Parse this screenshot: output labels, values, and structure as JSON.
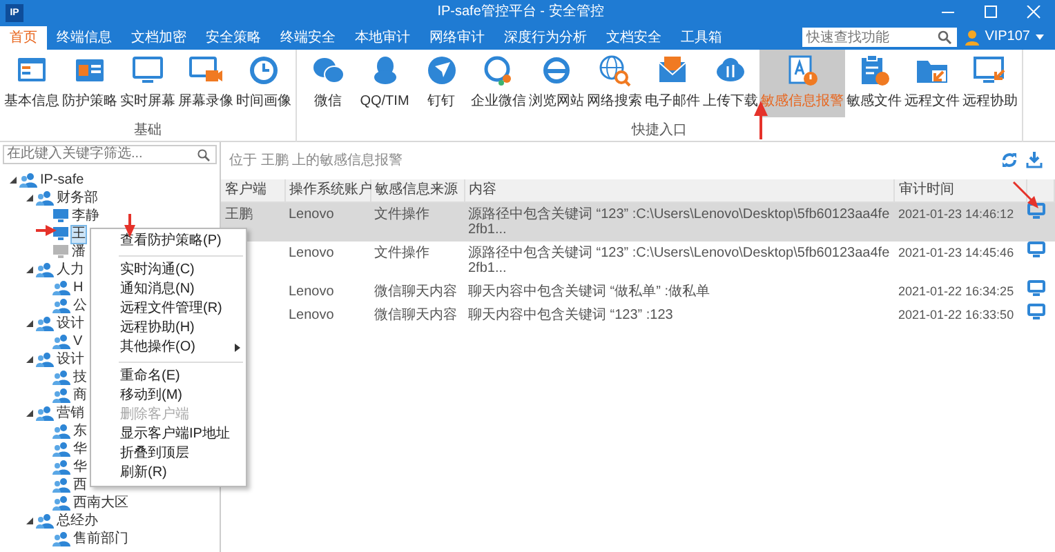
{
  "window": {
    "logo": "IP",
    "title": "IP-safe管控平台 - 安全管控"
  },
  "tabs": [
    {
      "label": "首页",
      "selected": true
    },
    {
      "label": "终端信息",
      "selected": false
    },
    {
      "label": "文档加密",
      "selected": false
    },
    {
      "label": "安全策略",
      "selected": false
    },
    {
      "label": "终端安全",
      "selected": false
    },
    {
      "label": "本地审计",
      "selected": false
    },
    {
      "label": "网络审计",
      "selected": false
    },
    {
      "label": "深度行为分析",
      "selected": false
    },
    {
      "label": "文档安全",
      "selected": false
    },
    {
      "label": "工具箱",
      "selected": false
    }
  ],
  "quick_search": {
    "placeholder": "快速查找功能"
  },
  "user": {
    "name": "VIP107"
  },
  "ribbon": {
    "groups": [
      {
        "title": "基础",
        "buttons": [
          {
            "label": "基本信息",
            "selected": false
          },
          {
            "label": "防护策略",
            "selected": false
          },
          {
            "label": "实时屏幕",
            "selected": false
          },
          {
            "label": "屏幕录像",
            "selected": false
          },
          {
            "label": "时间画像",
            "selected": false
          }
        ]
      },
      {
        "title": "快捷入口",
        "buttons": [
          {
            "label": "微信",
            "selected": false
          },
          {
            "label": "QQ/TIM",
            "selected": false
          },
          {
            "label": "钉钉",
            "selected": false
          },
          {
            "label": "企业微信",
            "selected": false
          },
          {
            "label": "浏览网站",
            "selected": false
          },
          {
            "label": "网络搜索",
            "selected": false
          },
          {
            "label": "电子邮件",
            "selected": false
          },
          {
            "label": "上传下载",
            "selected": false
          },
          {
            "label": "敏感信息报警",
            "selected": true
          },
          {
            "label": "敏感文件",
            "selected": false
          },
          {
            "label": "远程文件",
            "selected": false
          },
          {
            "label": "远程协助",
            "selected": false
          }
        ]
      }
    ]
  },
  "sidebar": {
    "filter": {
      "placeholder": "在此键入关键字筛选..."
    },
    "tree": [
      {
        "kind": "group",
        "label": "IP-safe",
        "selected": false,
        "expanded": true,
        "children": [
          {
            "kind": "group",
            "label": "财务部",
            "selected": false,
            "expanded": true,
            "children": [
              {
                "kind": "client",
                "label": "李静",
                "selected": false,
                "online": true
              },
              {
                "kind": "client",
                "label": "王",
                "selected": true,
                "online": true
              },
              {
                "kind": "client",
                "label": "潘",
                "selected": false,
                "online": false
              }
            ]
          },
          {
            "kind": "group",
            "label": "人力",
            "selected": false,
            "expanded": true,
            "children": [
              {
                "kind": "group",
                "label": "H",
                "selected": false
              },
              {
                "kind": "group",
                "label": "公",
                "selected": false
              }
            ]
          },
          {
            "kind": "group",
            "label": "设计",
            "selected": false,
            "expanded": true,
            "children": [
              {
                "kind": "group",
                "label": "V",
                "selected": false
              }
            ]
          },
          {
            "kind": "group",
            "label": "设计",
            "selected": false,
            "expanded": true,
            "children": [
              {
                "kind": "group",
                "label": "技",
                "selected": false
              },
              {
                "kind": "group",
                "label": "商",
                "selected": false
              }
            ]
          },
          {
            "kind": "group",
            "label": "营销",
            "selected": false,
            "expanded": true,
            "children": [
              {
                "kind": "group",
                "label": "东",
                "selected": false
              },
              {
                "kind": "group",
                "label": "华",
                "selected": false
              },
              {
                "kind": "group",
                "label": "华",
                "selected": false
              },
              {
                "kind": "group",
                "label": "西",
                "selected": false
              },
              {
                "kind": "group",
                "label": "西南大区",
                "selected": false
              }
            ]
          },
          {
            "kind": "group",
            "label": "总经办",
            "selected": false,
            "expanded": true,
            "children": [
              {
                "kind": "group",
                "label": "售前部门",
                "selected": false
              }
            ]
          }
        ]
      }
    ]
  },
  "alerts": {
    "heading": "位于 王鹏 上的敏感信息报警",
    "table": {
      "columns": [
        "客户端",
        "操作系统账户",
        "敏感信息来源",
        "内容",
        "审计时间"
      ],
      "rows": [
        {
          "selected": true,
          "client": "王鹏",
          "account": "Lenovo",
          "source": "文件操作",
          "content": "源路径中包含关键词 “123” :C:\\Users\\Lenovo\\Desktop\\5fb60123aa4fe2fb1...",
          "time": "2021-01-23 14:46:12"
        },
        {
          "selected": false,
          "account": "Lenovo",
          "source": "文件操作",
          "content": "源路径中包含关键词 “123” :C:\\Users\\Lenovo\\Desktop\\5fb60123aa4fe2fb1...",
          "time": "2021-01-23 14:45:46"
        },
        {
          "selected": false,
          "account": "Lenovo",
          "source": "微信聊天内容",
          "content": "聊天内容中包含关键词 “做私单” :做私单",
          "time": "2021-01-22 16:34:25"
        },
        {
          "selected": false,
          "account": "Lenovo",
          "source": "微信聊天内容",
          "content": "聊天内容中包含关键词 “123” :123",
          "time": "2021-01-22 16:33:50"
        }
      ]
    }
  },
  "context_menu": {
    "items": [
      {
        "kind": "item",
        "label": "查看防护策略(P)",
        "disabled": false,
        "has_submenu": false
      },
      {
        "kind": "separator"
      },
      {
        "kind": "item",
        "label": "实时沟通(C)",
        "disabled": false,
        "has_submenu": false
      },
      {
        "kind": "item",
        "label": "通知消息(N)",
        "disabled": false,
        "has_submenu": false
      },
      {
        "kind": "item",
        "label": "远程文件管理(R)",
        "disabled": false,
        "has_submenu": false
      },
      {
        "kind": "item",
        "label": "远程协助(H)",
        "disabled": false,
        "has_submenu": false
      },
      {
        "kind": "item",
        "label": "其他操作(O)",
        "disabled": false,
        "has_submenu": true
      },
      {
        "kind": "separator"
      },
      {
        "kind": "item",
        "label": "重命名(E)",
        "disabled": false,
        "has_submenu": false
      },
      {
        "kind": "item",
        "label": "移动到(M)",
        "disabled": false,
        "has_submenu": false
      },
      {
        "kind": "item",
        "label": "删除客户端",
        "disabled": true,
        "has_submenu": false
      },
      {
        "kind": "item",
        "label": "显示客户端IP地址",
        "disabled": false,
        "has_submenu": false
      },
      {
        "kind": "item",
        "label": "折叠到顶层",
        "disabled": false,
        "has_submenu": false
      },
      {
        "kind": "item",
        "label": "刷新(R)",
        "disabled": false,
        "has_submenu": false
      }
    ]
  }
}
